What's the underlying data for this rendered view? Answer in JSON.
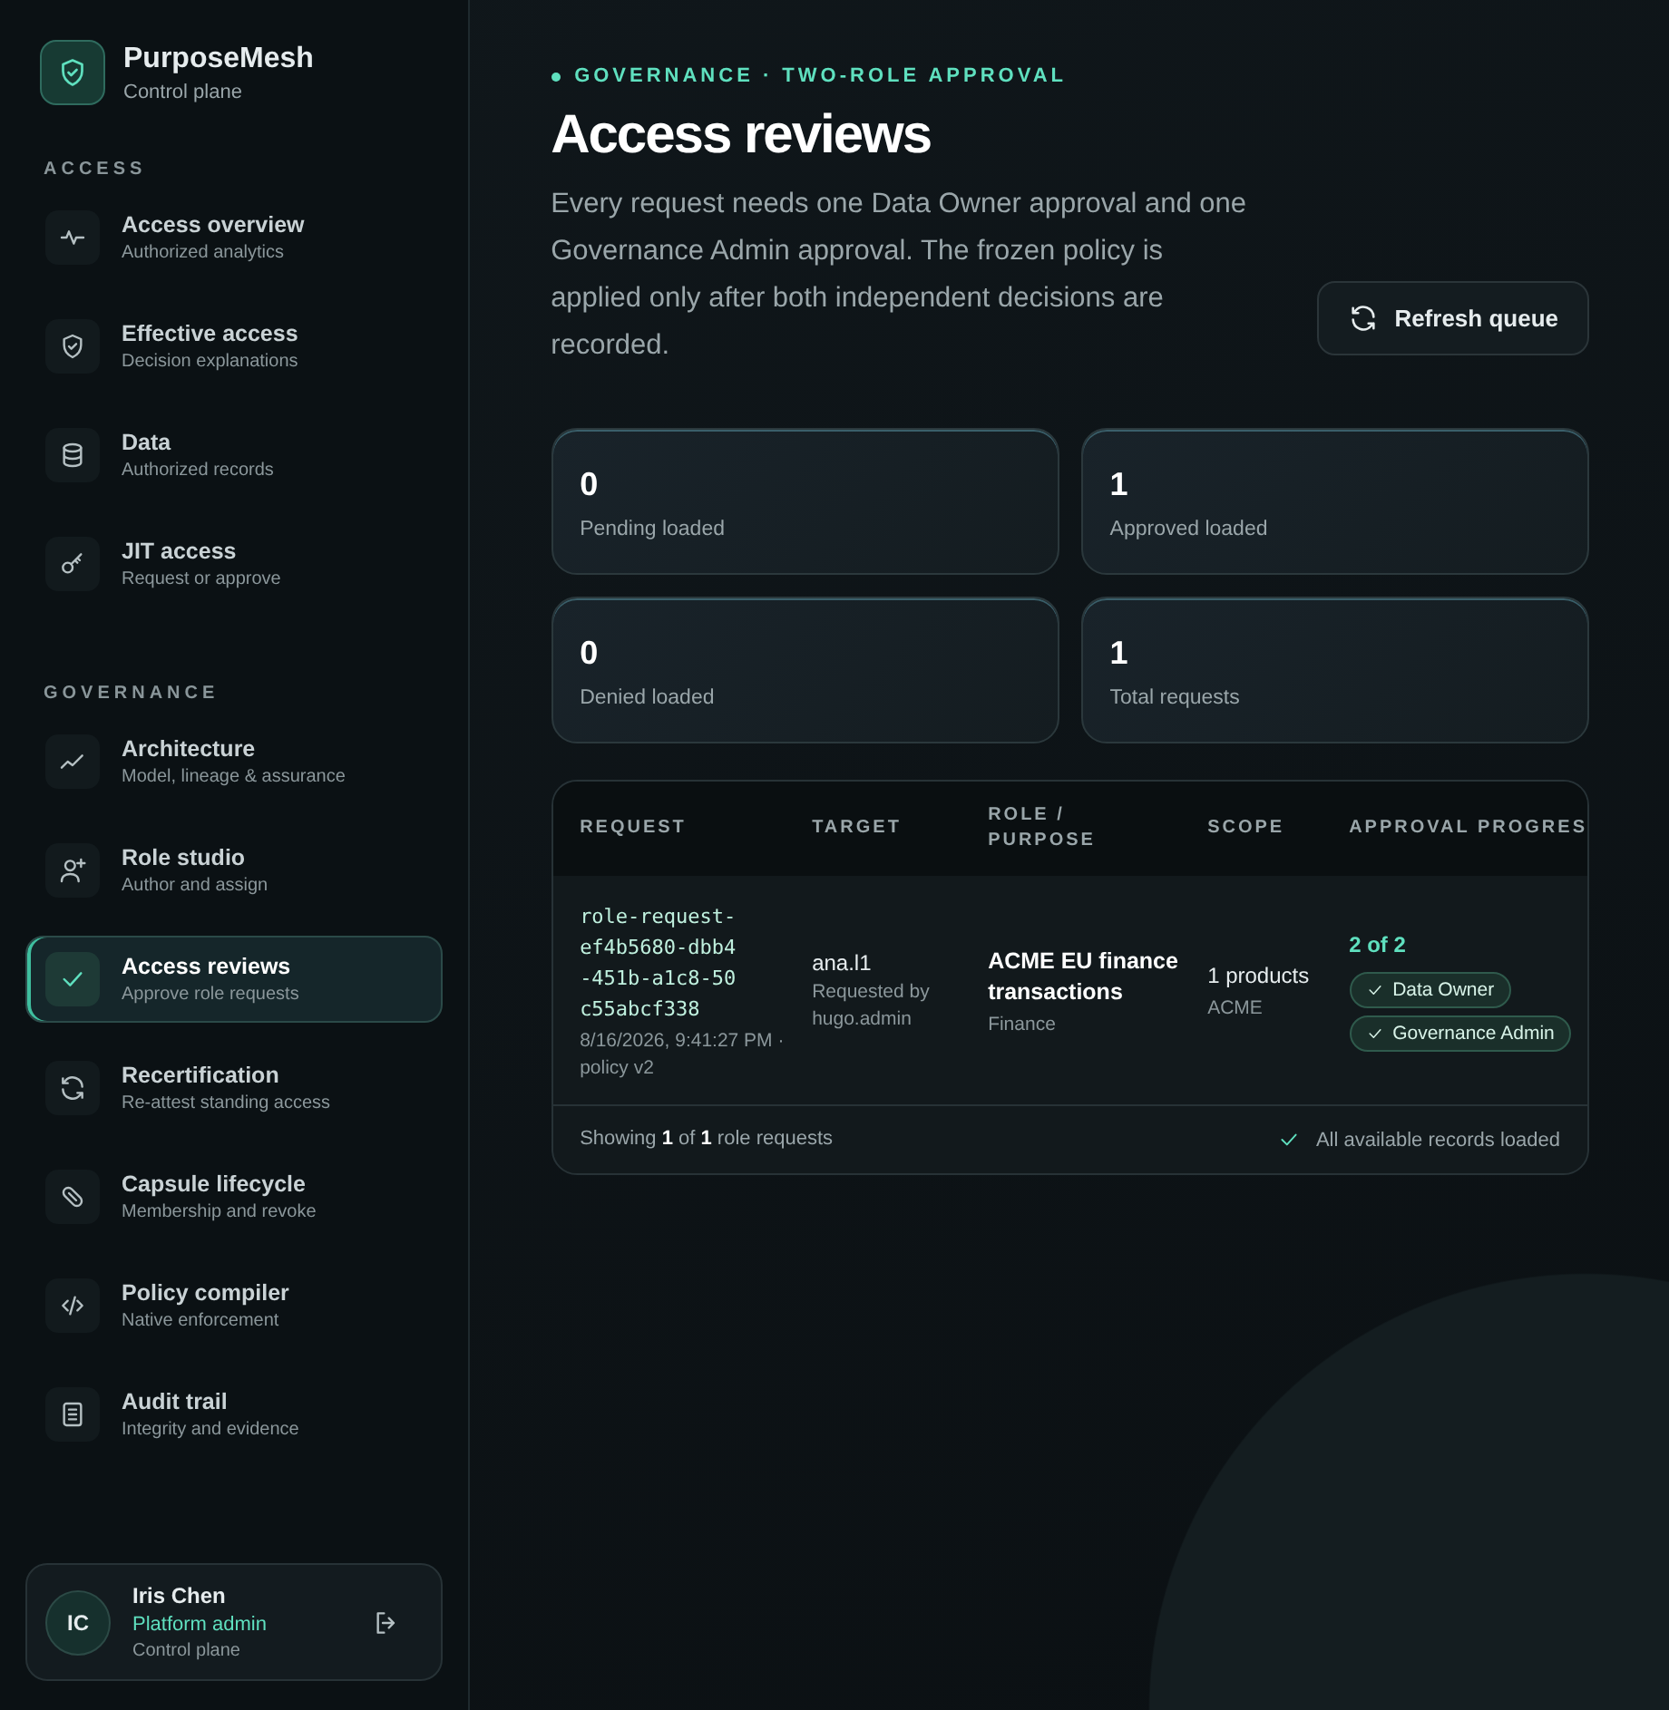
{
  "brand": {
    "name": "PurposeMesh",
    "subtitle": "Control plane"
  },
  "sidebar": {
    "sections": [
      {
        "heading": "ACCESS",
        "items": [
          {
            "title": "Access overview",
            "subtitle": "Authorized analytics",
            "selected": false
          },
          {
            "title": "Effective access",
            "subtitle": "Decision explanations",
            "selected": false
          },
          {
            "title": "Data",
            "subtitle": "Authorized records",
            "selected": false
          },
          {
            "title": "JIT access",
            "subtitle": "Request or approve",
            "selected": false
          }
        ]
      },
      {
        "heading": "GOVERNANCE",
        "items": [
          {
            "title": "Architecture",
            "subtitle": "Model, lineage & assurance",
            "selected": false
          },
          {
            "title": "Role studio",
            "subtitle": "Author and assign",
            "selected": false
          },
          {
            "title": "Access reviews",
            "subtitle": "Approve role requests",
            "selected": true
          },
          {
            "title": "Recertification",
            "subtitle": "Re-attest standing access",
            "selected": false
          },
          {
            "title": "Capsule lifecycle",
            "subtitle": "Membership and revoke",
            "selected": false
          },
          {
            "title": "Policy compiler",
            "subtitle": "Native enforcement",
            "selected": false
          },
          {
            "title": "Audit trail",
            "subtitle": "Integrity and evidence",
            "selected": false
          }
        ]
      }
    ]
  },
  "user": {
    "initials": "IC",
    "name": "Iris Chen",
    "role": "Platform admin",
    "context": "Control plane"
  },
  "header": {
    "eyebrow": "GOVERNANCE · TWO-ROLE APPROVAL",
    "title": "Access reviews",
    "description": "Every request needs one Data Owner approval and one Governance Admin approval. The frozen policy is applied only after both independent decisions are recorded.",
    "refresh_button": "Refresh queue"
  },
  "stats": [
    {
      "value": "0",
      "label": "Pending loaded"
    },
    {
      "value": "1",
      "label": "Approved loaded"
    },
    {
      "value": "0",
      "label": "Denied loaded"
    },
    {
      "value": "1",
      "label": "Total requests"
    }
  ],
  "table": {
    "columns": [
      "REQUEST",
      "TARGET",
      "ROLE / PURPOSE",
      "SCOPE",
      "APPROVAL PROGRES"
    ],
    "rows": [
      {
        "request_id": "role-request-ef4b5680-dbb4-451b-a1c8-50c55abcf338",
        "request_meta": "8/16/2026, 9:41:27 PM · policy v2",
        "target": "ana.l1",
        "target_meta": "Requested by hugo.admin",
        "role": "ACME EU finance transactions",
        "purpose": "Finance",
        "scope": "1 products",
        "scope_meta": "ACME",
        "progress": "2 of 2",
        "approvals": [
          {
            "label": "Data Owner",
            "checked": true
          },
          {
            "label": "Governance Admin",
            "checked": true
          }
        ]
      }
    ],
    "footer": "Showing **1** of **1** role requests",
    "status": "All available records loaded"
  }
}
